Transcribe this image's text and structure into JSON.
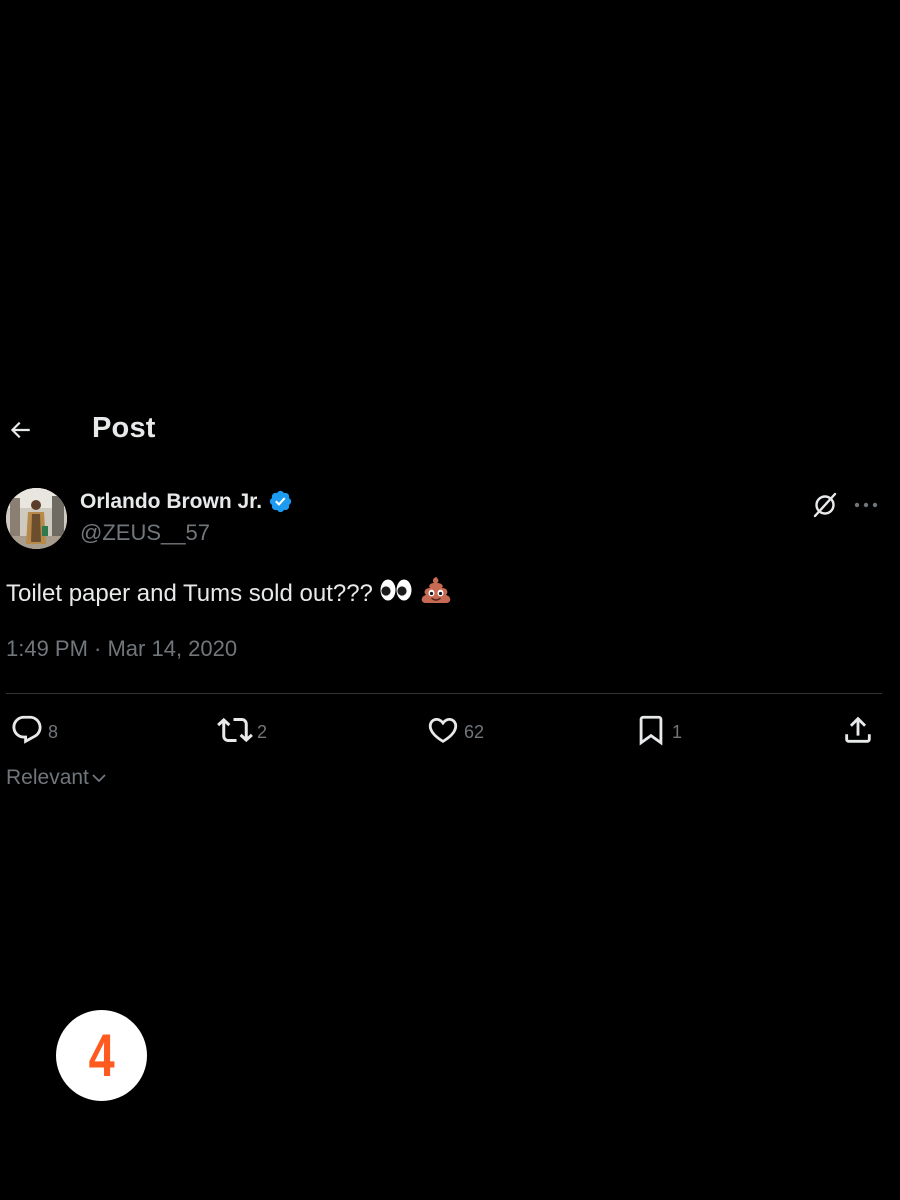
{
  "header": {
    "title": "Post"
  },
  "post": {
    "author_name": "Orlando Brown Jr.",
    "handle": "@ZEUS__57",
    "text": "Toilet paper and Tums sold out???",
    "emojis": [
      "eyes-emoji",
      "pile-of-poo-emoji"
    ],
    "timestamp": "1:49 PM · Mar 14, 2020",
    "verified_color": "#1d9bf0"
  },
  "actions": {
    "replies": "8",
    "reposts": "2",
    "likes": "62",
    "bookmarks": "1"
  },
  "sort": {
    "label": "Relevant"
  },
  "overlay": {
    "number": "4",
    "number_color": "#ff5a1f"
  },
  "colors": {
    "background": "#000000",
    "text_primary": "#e7e9ea",
    "text_secondary": "#71767b",
    "divider": "#2f3336"
  }
}
